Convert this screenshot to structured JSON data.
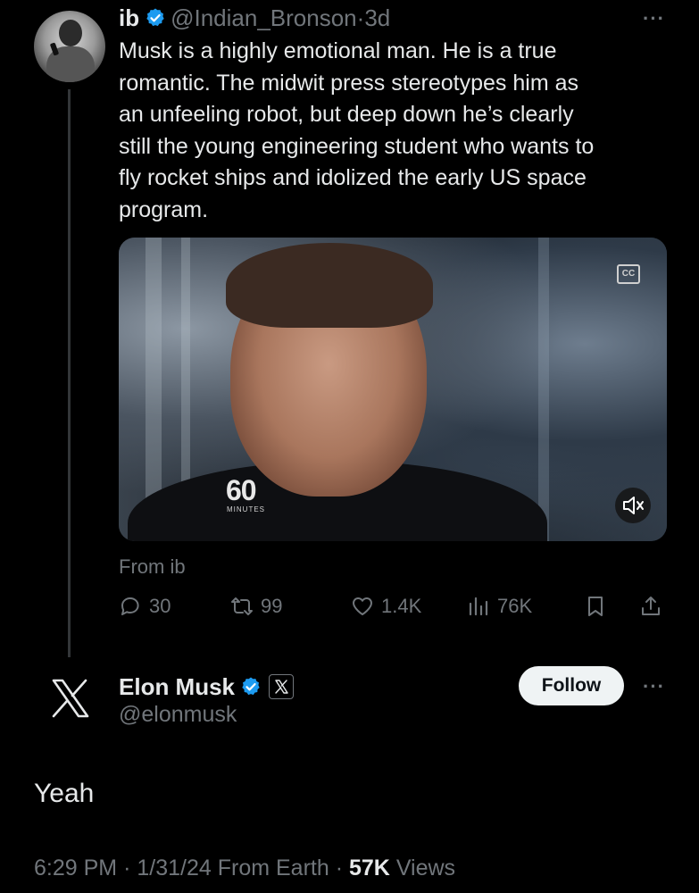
{
  "tweet": {
    "display_name": "ib",
    "handle": "@Indian_Bronson",
    "separator": "·",
    "age": "3d",
    "text_lines": [
      "Musk is a highly emotional man. He is a true",
      "romantic. The midwit press stereotypes him  as",
      "an unfeeling robot, but deep down he’s clearly",
      "still the young engineering student who wants to",
      "fly rocket ships and idolized the early US space",
      "program."
    ],
    "media": {
      "logo_main": "60",
      "logo_sub": "MINUTES",
      "cc_label": "CC"
    },
    "from_label": "From ib",
    "actions": {
      "replies": "30",
      "reposts": "99",
      "likes": "1.4K",
      "views": "76K"
    },
    "more_dots": "···"
  },
  "reply": {
    "display_name": "Elon Musk",
    "handle": "@elonmusk",
    "follow_label": "Follow",
    "more_dots": "···",
    "text": "Yeah",
    "time": "6:29 PM",
    "sep1": "·",
    "date": "1/31/24",
    "source": "From Earth",
    "sep2": "·",
    "views_count": "57K",
    "views_label": "Views"
  },
  "colors": {
    "background": "#000000",
    "text_primary": "#e7e9ea",
    "text_secondary": "#71767b",
    "verified_blue": "#1d9bf0",
    "thread_line": "#333639"
  },
  "icons": {
    "reply": "reply-icon",
    "repost": "repost-icon",
    "like": "heart-icon",
    "views": "analytics-icon",
    "bookmark": "bookmark-icon",
    "share": "share-icon",
    "mute": "mute-icon",
    "captions": "captions-icon",
    "verified": "verified-badge-icon",
    "x_logo": "x-logo-icon"
  }
}
